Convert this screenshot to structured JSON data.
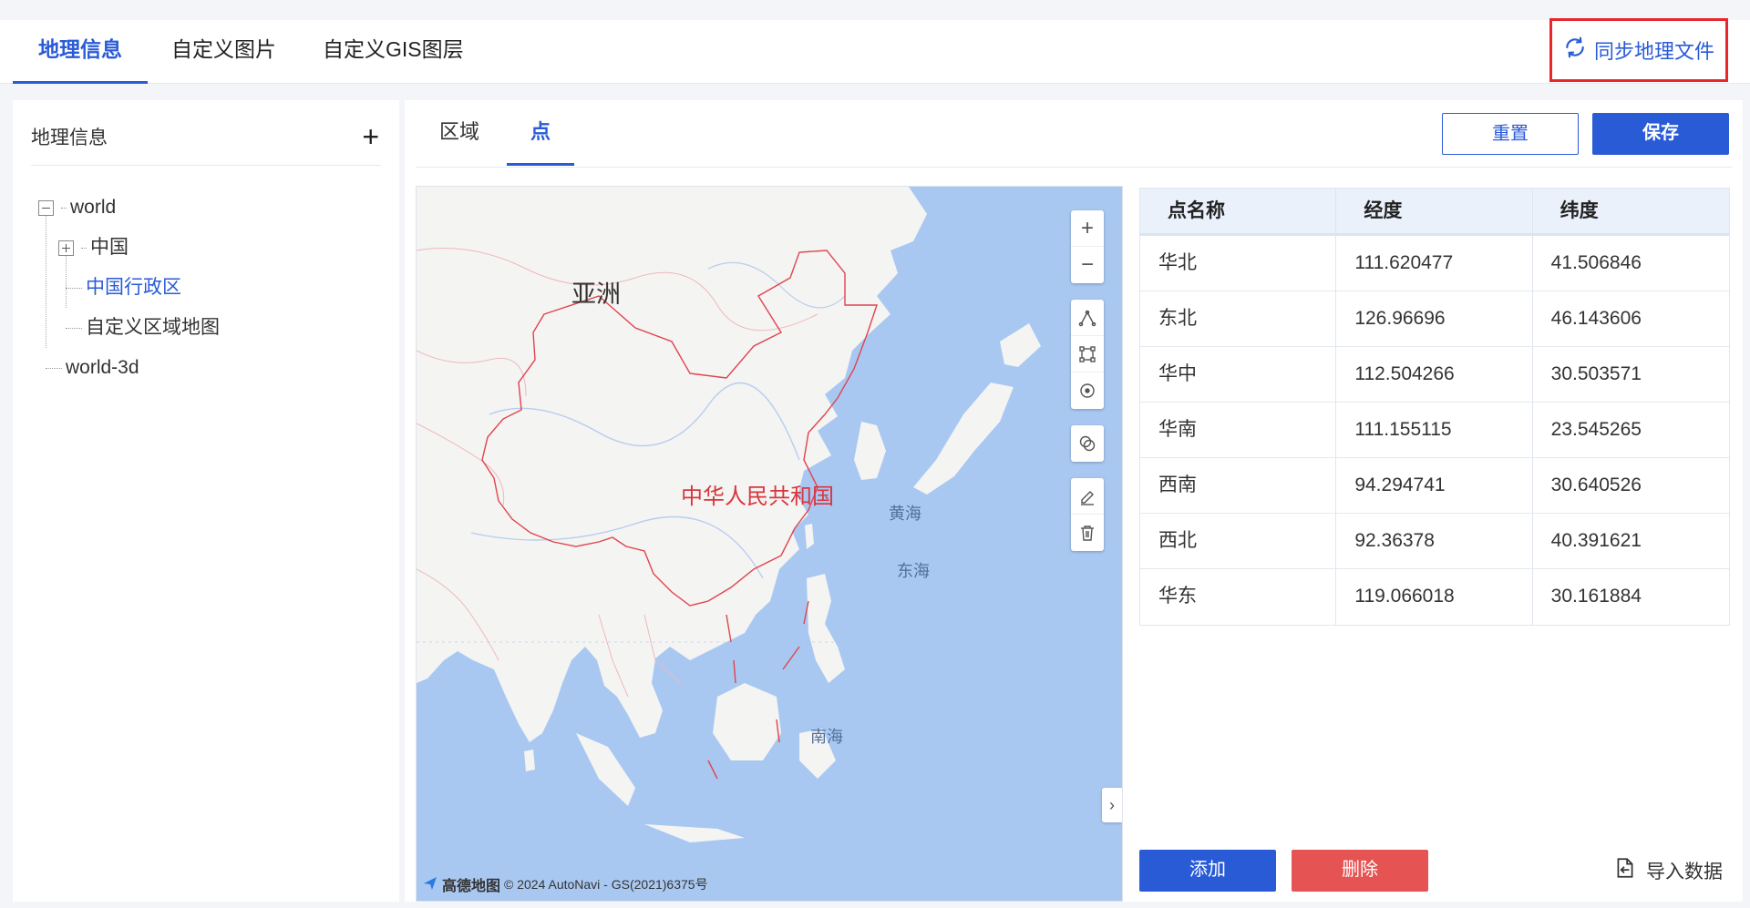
{
  "top_tabs": [
    {
      "label": "地理信息",
      "active": true
    },
    {
      "label": "自定义图片",
      "active": false
    },
    {
      "label": "自定义GIS图层",
      "active": false
    }
  ],
  "sync_button": {
    "label": "同步地理文件"
  },
  "left_panel": {
    "title": "地理信息",
    "add_icon": "plus-icon",
    "tree": [
      {
        "label": "world",
        "expanded": true
      },
      {
        "label": "中国",
        "expanded": false
      },
      {
        "label": "中国行政区",
        "selected": true
      },
      {
        "label": "自定义区域地图"
      },
      {
        "label": "world-3d"
      }
    ]
  },
  "sub_tabs": [
    {
      "label": "区域",
      "active": false
    },
    {
      "label": "点",
      "active": true
    }
  ],
  "actions": {
    "reset": "重置",
    "save": "保存"
  },
  "map": {
    "labels": {
      "asia": "亚洲",
      "china": "中华人民共和国",
      "yellow_sea": "黄海",
      "east_sea": "东海",
      "south_sea": "南海"
    },
    "attribution": {
      "brand": "高德地图",
      "text": "© 2024 AutoNavi - GS(2021)6375号"
    },
    "tools": [
      "zoom-in-icon",
      "zoom-out-icon",
      "draw-line-icon",
      "draw-rect-icon",
      "draw-point-icon",
      "overlap-icon",
      "edit-icon",
      "delete-icon"
    ]
  },
  "table": {
    "headers": [
      "点名称",
      "经度",
      "纬度"
    ],
    "rows": [
      {
        "name": "华北",
        "lng": "111.620477",
        "lat": "41.506846"
      },
      {
        "name": "东北",
        "lng": "126.96696",
        "lat": "46.143606"
      },
      {
        "name": "华中",
        "lng": "112.504266",
        "lat": "30.503571"
      },
      {
        "name": "华南",
        "lng": "111.155115",
        "lat": "23.545265"
      },
      {
        "name": "西南",
        "lng": "94.294741",
        "lat": "30.640526"
      },
      {
        "name": "西北",
        "lng": "92.36378",
        "lat": "40.391621"
      },
      {
        "name": "华东",
        "lng": "119.066018",
        "lat": "30.161884"
      }
    ]
  },
  "bottom_actions": {
    "add": "添加",
    "delete": "删除",
    "import": "导入数据"
  },
  "colors": {
    "primary": "#2a5bd7",
    "danger": "#e55353",
    "highlight": "#e8262b",
    "sea": "#a9c8f1",
    "land": "#f4f4f2"
  }
}
